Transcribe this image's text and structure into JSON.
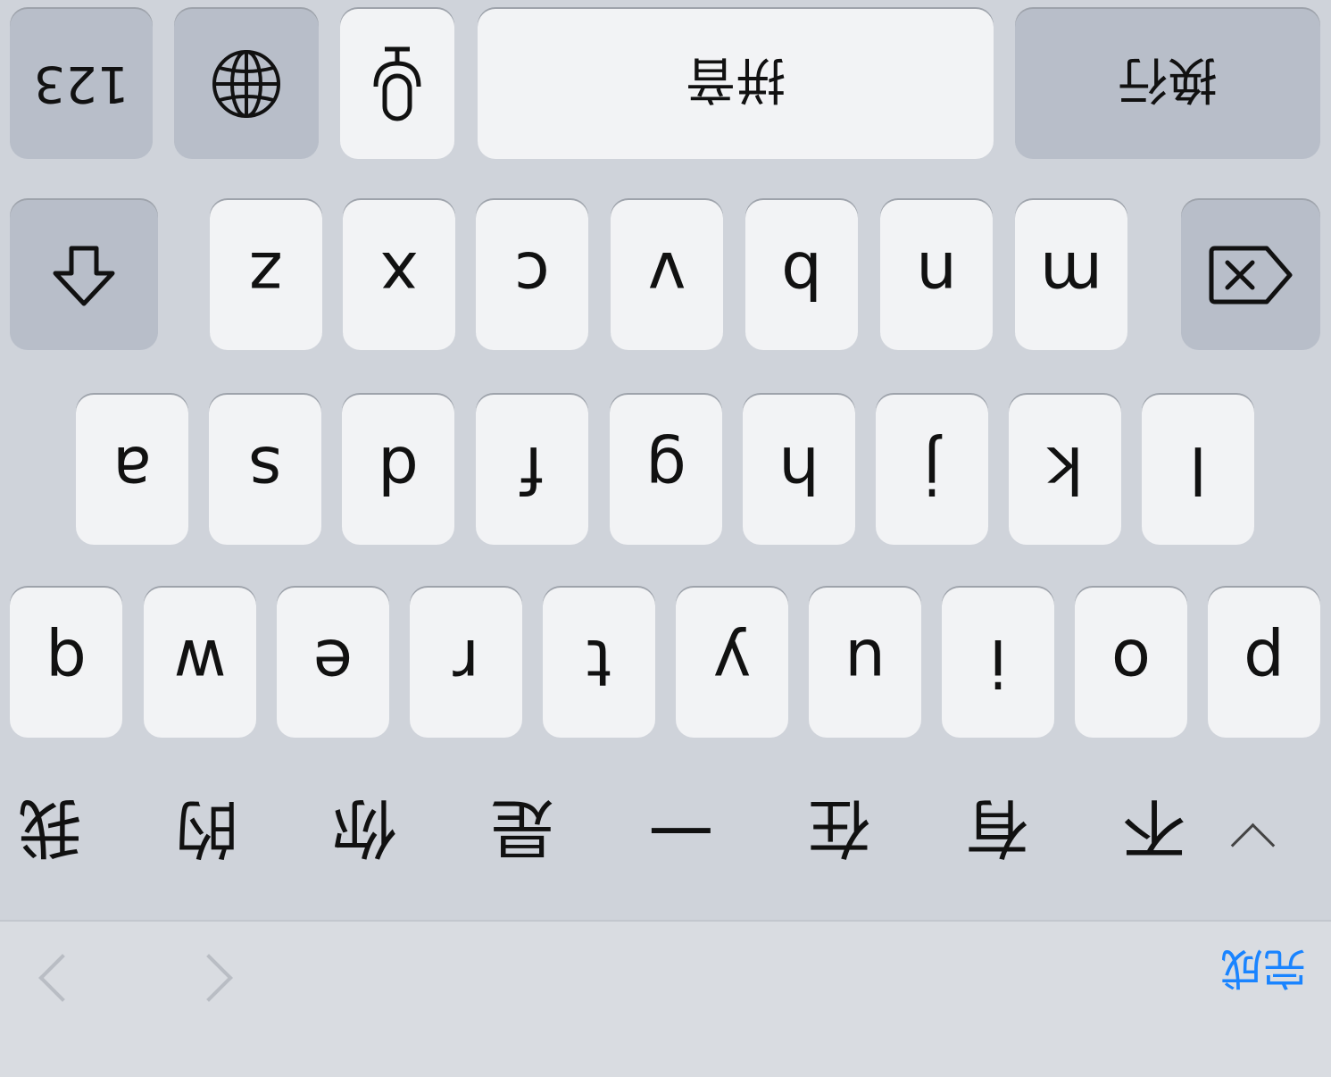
{
  "toolbar": {
    "done_label": "完成",
    "nav_prev_icon": "chevron-left-icon",
    "nav_next_icon": "chevron-right-icon"
  },
  "suggestions": [
    "我",
    "的",
    "你",
    "是",
    "一",
    "在",
    "有",
    "不"
  ],
  "suggestions_expand_icon": "chevron-down-icon",
  "rows": {
    "row1": [
      "q",
      "w",
      "e",
      "r",
      "t",
      "y",
      "u",
      "i",
      "o",
      "p"
    ],
    "row2": [
      "a",
      "s",
      "d",
      "f",
      "g",
      "h",
      "j",
      "k",
      "l"
    ],
    "row3": [
      "z",
      "x",
      "c",
      "v",
      "b",
      "n",
      "m"
    ]
  },
  "bottom": {
    "numbers_label": "123",
    "space_label": "拼音",
    "return_label": "换行",
    "globe_icon": "globe-icon",
    "mic_icon": "microphone-icon",
    "shift_icon": "shift-icon",
    "delete_icon": "delete-icon"
  },
  "colors": {
    "accent": "#1a84ff",
    "key_bg": "#f2f3f5",
    "dark_key_bg": "#b8bec9",
    "keyboard_bg": "#cfd3da"
  }
}
